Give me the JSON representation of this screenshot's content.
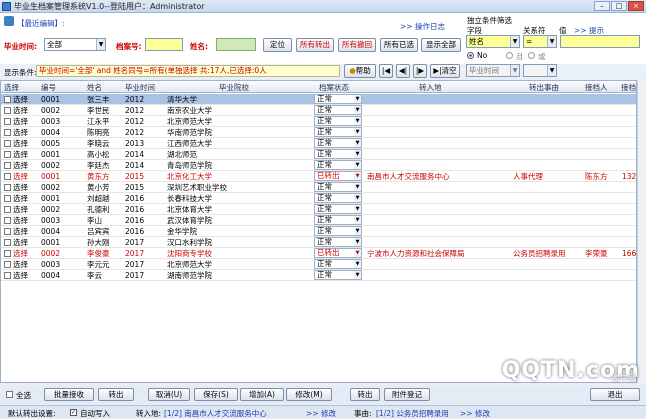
{
  "window": {
    "title": "毕业生档案管理系统V1.0--登陆用户：Administrator",
    "controls": [
      "–",
      "□",
      "×"
    ]
  },
  "panel": {
    "recent_label": "【最近编辑】:",
    "log_link": ">> 操作日志",
    "grad_time_label": "毕业时间:",
    "grad_time_value": "全部",
    "archive_no_label": "档案号:",
    "name_label": "姓名:",
    "locate": "定位",
    "all_transferred": "所有转出",
    "all_cancelled": "所有撤回",
    "all_selected": "所有已选",
    "show_all": "显示全部",
    "separate_cond_label": "独立条件筛选",
    "field_label": "字段",
    "relation_label": "关系符",
    "value_label": "值",
    "tip_link": ">> 提示",
    "field_value": "姓名",
    "relation_value": "=",
    "radio_no": "No",
    "radio_and": "且",
    "radio_or": "或",
    "field2_value": "毕业时间"
  },
  "cond": {
    "label": "显示条件:",
    "text": "毕业时间='全部' and 姓名同号=所有(单独选择 共:17人,已选择:0人",
    "help": "帮助",
    "clear": "清空"
  },
  "grid": {
    "headers": [
      "选择",
      "编号",
      "姓名",
      "毕业时间",
      "毕业院校",
      "档案状态",
      "转入地",
      "转出事由",
      "接档人",
      "接档"
    ],
    "rows": [
      {
        "sel": "选择",
        "no": "0001",
        "name": "张三丰",
        "year": "2012",
        "school": "清华大学",
        "status": "正常",
        "to": "",
        "reason": "",
        "handler": "",
        "code": "",
        "red": false,
        "selected": true
      },
      {
        "sel": "选择",
        "no": "0002",
        "name": "李世民",
        "year": "2012",
        "school": "南京农业大学",
        "status": "正常",
        "to": "",
        "reason": "",
        "handler": "",
        "code": "",
        "red": false,
        "selected": false
      },
      {
        "sel": "选择",
        "no": "0003",
        "name": "江永平",
        "year": "2012",
        "school": "北京师范大学",
        "status": "正常",
        "to": "",
        "reason": "",
        "handler": "",
        "code": "",
        "red": false,
        "selected": false
      },
      {
        "sel": "选择",
        "no": "0004",
        "name": "陈明亮",
        "year": "2012",
        "school": "华南师范学院",
        "status": "正常",
        "to": "",
        "reason": "",
        "handler": "",
        "code": "",
        "red": false,
        "selected": false
      },
      {
        "sel": "选择",
        "no": "0005",
        "name": "李晓云",
        "year": "2013",
        "school": "江西师范大学",
        "status": "正常",
        "to": "",
        "reason": "",
        "handler": "",
        "code": "",
        "red": false,
        "selected": false
      },
      {
        "sel": "选择",
        "no": "0001",
        "name": "高小松",
        "year": "2014",
        "school": "湖北师范",
        "status": "正常",
        "to": "",
        "reason": "",
        "handler": "",
        "code": "",
        "red": false,
        "selected": false
      },
      {
        "sel": "选择",
        "no": "0002",
        "name": "李廷杰",
        "year": "2014",
        "school": "青岛师范学院",
        "status": "正常",
        "to": "",
        "reason": "",
        "handler": "",
        "code": "",
        "red": false,
        "selected": false
      },
      {
        "sel": "选择",
        "no": "0001",
        "name": "黄东方",
        "year": "2015",
        "school": "北京化工大学",
        "status": "已转出",
        "to": "南昌市人才交流服务中心",
        "reason": "人事代理",
        "handler": "陈东方",
        "code": "132",
        "red": true,
        "selected": false
      },
      {
        "sel": "选择",
        "no": "0002",
        "name": "黄小芳",
        "year": "2015",
        "school": "深圳艺术职业学校",
        "status": "正常",
        "to": "",
        "reason": "",
        "handler": "",
        "code": "",
        "red": false,
        "selected": false
      },
      {
        "sel": "选择",
        "no": "0001",
        "name": "刘超越",
        "year": "2016",
        "school": "长春科技大学",
        "status": "正常",
        "to": "",
        "reason": "",
        "handler": "",
        "code": "",
        "red": false,
        "selected": false
      },
      {
        "sel": "选择",
        "no": "0002",
        "name": "孔德利",
        "year": "2016",
        "school": "北京体育大学",
        "status": "正常",
        "to": "",
        "reason": "",
        "handler": "",
        "code": "",
        "red": false,
        "selected": false
      },
      {
        "sel": "选择",
        "no": "0003",
        "name": "李山",
        "year": "2016",
        "school": "武汉体育学院",
        "status": "正常",
        "to": "",
        "reason": "",
        "handler": "",
        "code": "",
        "red": false,
        "selected": false
      },
      {
        "sel": "选择",
        "no": "0004",
        "name": "吕宾宾",
        "year": "2016",
        "school": "金华学院",
        "status": "正常",
        "to": "",
        "reason": "",
        "handler": "",
        "code": "",
        "red": false,
        "selected": false
      },
      {
        "sel": "选择",
        "no": "0001",
        "name": "孙大刚",
        "year": "2017",
        "school": "汉口水利学院",
        "status": "正常",
        "to": "",
        "reason": "",
        "handler": "",
        "code": "",
        "red": false,
        "selected": false
      },
      {
        "sel": "选择",
        "no": "0002",
        "name": "李俊豪",
        "year": "2017",
        "school": "沈阳商专学校",
        "status": "已转出",
        "to": "宁波市人力资源和社会保障局",
        "reason": "公务员招聘录用",
        "handler": "李荣豪",
        "code": "166",
        "red": true,
        "selected": false
      },
      {
        "sel": "选择",
        "no": "0003",
        "name": "李元元",
        "year": "2017",
        "school": "北京师范大学",
        "status": "正常",
        "to": "",
        "reason": "",
        "handler": "",
        "code": "",
        "red": false,
        "selected": false
      },
      {
        "sel": "选择",
        "no": "0004",
        "name": "李云",
        "year": "2017",
        "school": "湖南师范学院",
        "status": "正常",
        "to": "",
        "reason": "",
        "handler": "",
        "code": "",
        "red": false,
        "selected": false
      }
    ]
  },
  "buttons": {
    "select_all": "全选",
    "batch_receive": "批量接收",
    "transfer_out": "转出",
    "cancel": "取消(U)",
    "save": "保存(S)",
    "add": "增加(A)",
    "modify": "修改(M)",
    "transfer": "转出",
    "print": "附件登记",
    "exit": "退出"
  },
  "status": {
    "default_label": "默认转出设置:",
    "auto_label": "自动写入",
    "transfer_to_label": "转入地:",
    "transfer_to_value": "[1/2] 南昌市人才交流服务中心",
    "modify1": ">> 修改",
    "reason_label": "事由:",
    "reason_value": "[1/2] 公务员招聘录用",
    "modify2": ">> 修改"
  },
  "watermark": {
    "main": "QQTN.com",
    "sub": "腾牛网"
  }
}
